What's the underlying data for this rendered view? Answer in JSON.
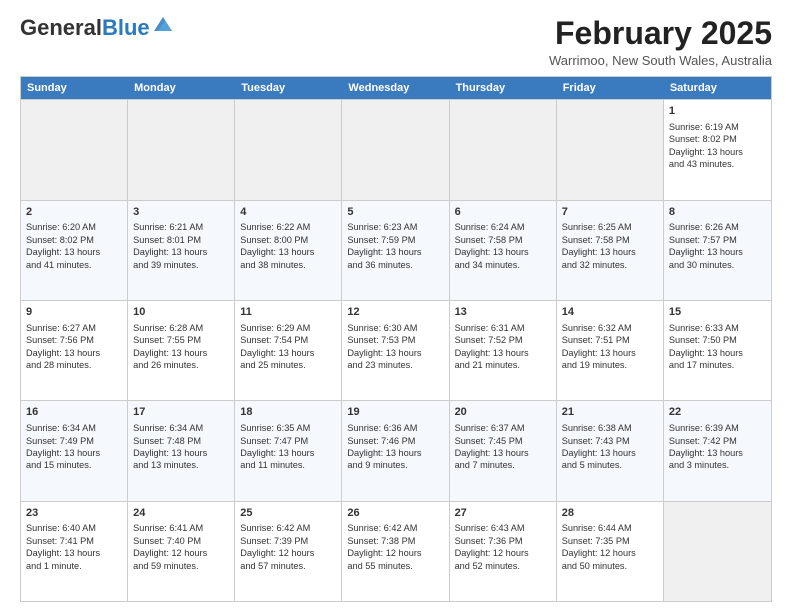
{
  "header": {
    "logo_general": "General",
    "logo_blue": "Blue",
    "month_title": "February 2025",
    "location": "Warrimoo, New South Wales, Australia"
  },
  "weekdays": [
    "Sunday",
    "Monday",
    "Tuesday",
    "Wednesday",
    "Thursday",
    "Friday",
    "Saturday"
  ],
  "rows": [
    [
      {
        "day": "",
        "text": "",
        "empty": true
      },
      {
        "day": "",
        "text": "",
        "empty": true
      },
      {
        "day": "",
        "text": "",
        "empty": true
      },
      {
        "day": "",
        "text": "",
        "empty": true
      },
      {
        "day": "",
        "text": "",
        "empty": true
      },
      {
        "day": "",
        "text": "",
        "empty": true
      },
      {
        "day": "1",
        "text": "Sunrise: 6:19 AM\nSunset: 8:02 PM\nDaylight: 13 hours\nand 43 minutes.",
        "empty": false
      }
    ],
    [
      {
        "day": "2",
        "text": "Sunrise: 6:20 AM\nSunset: 8:02 PM\nDaylight: 13 hours\nand 41 minutes.",
        "empty": false
      },
      {
        "day": "3",
        "text": "Sunrise: 6:21 AM\nSunset: 8:01 PM\nDaylight: 13 hours\nand 39 minutes.",
        "empty": false
      },
      {
        "day": "4",
        "text": "Sunrise: 6:22 AM\nSunset: 8:00 PM\nDaylight: 13 hours\nand 38 minutes.",
        "empty": false
      },
      {
        "day": "5",
        "text": "Sunrise: 6:23 AM\nSunset: 7:59 PM\nDaylight: 13 hours\nand 36 minutes.",
        "empty": false
      },
      {
        "day": "6",
        "text": "Sunrise: 6:24 AM\nSunset: 7:58 PM\nDaylight: 13 hours\nand 34 minutes.",
        "empty": false
      },
      {
        "day": "7",
        "text": "Sunrise: 6:25 AM\nSunset: 7:58 PM\nDaylight: 13 hours\nand 32 minutes.",
        "empty": false
      },
      {
        "day": "8",
        "text": "Sunrise: 6:26 AM\nSunset: 7:57 PM\nDaylight: 13 hours\nand 30 minutes.",
        "empty": false
      }
    ],
    [
      {
        "day": "9",
        "text": "Sunrise: 6:27 AM\nSunset: 7:56 PM\nDaylight: 13 hours\nand 28 minutes.",
        "empty": false
      },
      {
        "day": "10",
        "text": "Sunrise: 6:28 AM\nSunset: 7:55 PM\nDaylight: 13 hours\nand 26 minutes.",
        "empty": false
      },
      {
        "day": "11",
        "text": "Sunrise: 6:29 AM\nSunset: 7:54 PM\nDaylight: 13 hours\nand 25 minutes.",
        "empty": false
      },
      {
        "day": "12",
        "text": "Sunrise: 6:30 AM\nSunset: 7:53 PM\nDaylight: 13 hours\nand 23 minutes.",
        "empty": false
      },
      {
        "day": "13",
        "text": "Sunrise: 6:31 AM\nSunset: 7:52 PM\nDaylight: 13 hours\nand 21 minutes.",
        "empty": false
      },
      {
        "day": "14",
        "text": "Sunrise: 6:32 AM\nSunset: 7:51 PM\nDaylight: 13 hours\nand 19 minutes.",
        "empty": false
      },
      {
        "day": "15",
        "text": "Sunrise: 6:33 AM\nSunset: 7:50 PM\nDaylight: 13 hours\nand 17 minutes.",
        "empty": false
      }
    ],
    [
      {
        "day": "16",
        "text": "Sunrise: 6:34 AM\nSunset: 7:49 PM\nDaylight: 13 hours\nand 15 minutes.",
        "empty": false
      },
      {
        "day": "17",
        "text": "Sunrise: 6:34 AM\nSunset: 7:48 PM\nDaylight: 13 hours\nand 13 minutes.",
        "empty": false
      },
      {
        "day": "18",
        "text": "Sunrise: 6:35 AM\nSunset: 7:47 PM\nDaylight: 13 hours\nand 11 minutes.",
        "empty": false
      },
      {
        "day": "19",
        "text": "Sunrise: 6:36 AM\nSunset: 7:46 PM\nDaylight: 13 hours\nand 9 minutes.",
        "empty": false
      },
      {
        "day": "20",
        "text": "Sunrise: 6:37 AM\nSunset: 7:45 PM\nDaylight: 13 hours\nand 7 minutes.",
        "empty": false
      },
      {
        "day": "21",
        "text": "Sunrise: 6:38 AM\nSunset: 7:43 PM\nDaylight: 13 hours\nand 5 minutes.",
        "empty": false
      },
      {
        "day": "22",
        "text": "Sunrise: 6:39 AM\nSunset: 7:42 PM\nDaylight: 13 hours\nand 3 minutes.",
        "empty": false
      }
    ],
    [
      {
        "day": "23",
        "text": "Sunrise: 6:40 AM\nSunset: 7:41 PM\nDaylight: 13 hours\nand 1 minute.",
        "empty": false
      },
      {
        "day": "24",
        "text": "Sunrise: 6:41 AM\nSunset: 7:40 PM\nDaylight: 12 hours\nand 59 minutes.",
        "empty": false
      },
      {
        "day": "25",
        "text": "Sunrise: 6:42 AM\nSunset: 7:39 PM\nDaylight: 12 hours\nand 57 minutes.",
        "empty": false
      },
      {
        "day": "26",
        "text": "Sunrise: 6:42 AM\nSunset: 7:38 PM\nDaylight: 12 hours\nand 55 minutes.",
        "empty": false
      },
      {
        "day": "27",
        "text": "Sunrise: 6:43 AM\nSunset: 7:36 PM\nDaylight: 12 hours\nand 52 minutes.",
        "empty": false
      },
      {
        "day": "28",
        "text": "Sunrise: 6:44 AM\nSunset: 7:35 PM\nDaylight: 12 hours\nand 50 minutes.",
        "empty": false
      },
      {
        "day": "",
        "text": "",
        "empty": true
      }
    ]
  ]
}
